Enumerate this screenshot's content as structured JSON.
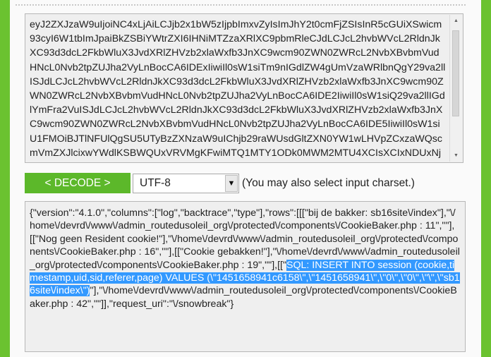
{
  "input": {
    "encoded_text": "eyJ2ZXJzaW9uIjoiNC4xLjAiLCJjb2x1bW5zIjpbImxvZyIsImJhY2t0cmFjZSIsInR5cGUiXSwicm93cyI6W1tbImJpaiBkZSBiYWtrZXI6IHNiMTZzaXRlXC9pbmRleCJdLCJcL2hvbWVcL2RldnJkXC93d3dcL2FkbWluX3JvdXRlZHVzb2xlaWxfb3JnXC9wcm90ZWN0ZWRcL2NvbXBvbmVudHNcL0Nvb2tpZUJha2VyLnBocCA6IDExIiwiIl0sW1siTm9nIGdlZW4gUmVzaWRlbnQgY29va2llISJdLCJcL2hvbWVcL2RldnJkXC93d3dcL2FkbWluX3JvdXRlZHVzb2xlaWxfb3JnXC9wcm90ZWN0ZWRcL2NvbXBvbmVudHNcL0Nvb2tpZUJha2VyLnBocCA6IDE2IiwiIl0sW1siQ29va2llIGdlYmFra2VuISJdLCJcL2hvbWVcL2RldnJkXC93d3dcL2FkbWluX3JvdXRlZHVzb2xlaWxfb3JnXC9wcm90ZWN0ZWRcL2NvbXBvbmVudHNcL0Nvb2tpZUJha2VyLnBocCA6IDE5IiwiIl0sW1siU1FMOiBJTlNFUlQgSU5UTyBzZXNzaW9uIChjb29raWUsdGltZXN0YW1wLHVpZCxzaWQscmVmZXJlcixwYWdlKSBWQUxVRVMgKFwiMTQ1MTY1ODk0MWM2MTU4XCIsXCIxNDUxNjU4OTQ",
    "scroll_up_icon": "triangle-up",
    "scroll_down_icon": "triangle-down"
  },
  "controls": {
    "decode_label": "< DECODE >",
    "charset_value": "UTF-8",
    "charset_arrow_glyph": "▼",
    "charset_hint": "(You may also select input charset.)"
  },
  "output": {
    "text_before_selection": "{\"version\":\"4.1.0\",\"columns\":[\"log\",\"backtrace\",\"type\"],\"rows\":[[[\"bij de bakker: sb16site\\/index\"],\"\\/home\\/devrd\\/www\\/admin_routedusoleil_org\\/protected\\/components\\/CookieBaker.php : 11\",\"\"],[[\"Nog geen Resident cookie!\"],\"\\/home\\/devrd\\/www\\/admin_routedusoleil_org\\/protected\\/components\\/CookieBaker.php : 16\",\"\"],[[\"Cookie gebakken!\"],\"\\/home\\/devrd\\/www\\/admin_routedusoleil_org\\/protected\\/components\\/CookieBaker.php : 19\",\"\"],[[\"",
    "selected_text": "SQL: INSERT INTO session (cookie,timestamp,uid,sid,referer,page) VALUES (\\\"1451658941c6158\\\",\\\"1451658941\\\",\\\"0\\\",\\\"0\\\",\\\"\\\",\\\"sb16site\\/index\\\")",
    "text_after_selection": "\"],\"\\/home\\/devrd\\/www\\/admin_routedusoleil_org\\/protected\\/components\\/CookieBaker.php : 42\",\"\"]],\"request_uri\":\"\\/snowbreak\"}"
  },
  "colors": {
    "accent_green": "#6bc230",
    "decode_button": "#5cb82a",
    "selection_highlight": "#3399ff"
  }
}
